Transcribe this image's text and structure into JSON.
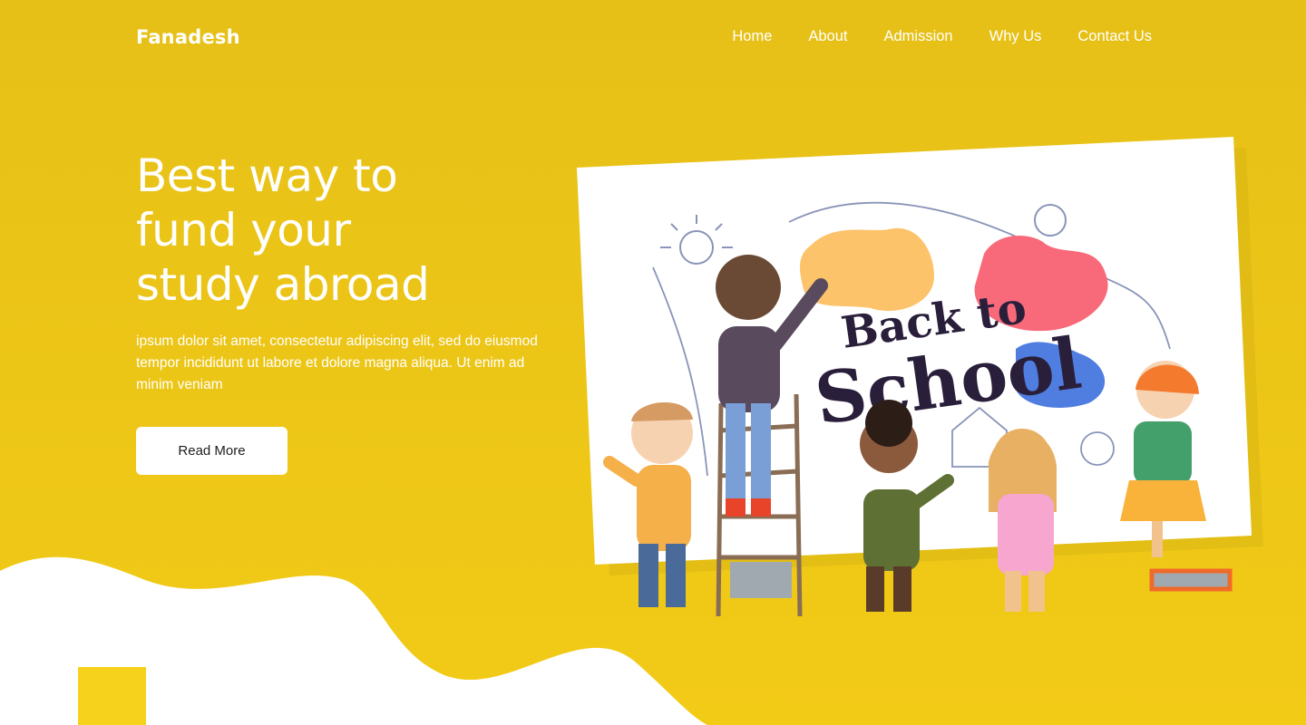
{
  "brand": {
    "name": "Fanadesh"
  },
  "nav": {
    "items": [
      {
        "label": "Home"
      },
      {
        "label": "About"
      },
      {
        "label": "Admission"
      },
      {
        "label": "Why Us"
      },
      {
        "label": "Contact Us"
      }
    ]
  },
  "hero": {
    "title_lines": [
      "Best way to",
      "fund your",
      "study abroad"
    ],
    "description": "ipsum dolor sit amet, consectetur adipiscing elit, sed do eiusmod tempor incididunt ut labore et dolore magna aliqua. Ut enim ad minim veniam",
    "cta_label": "Read More"
  },
  "illustration": {
    "line1": "Back to",
    "line2": "School"
  },
  "colors": {
    "background": "#e9c218",
    "accent_box": "#f7d21c",
    "text": "#ffffff"
  }
}
